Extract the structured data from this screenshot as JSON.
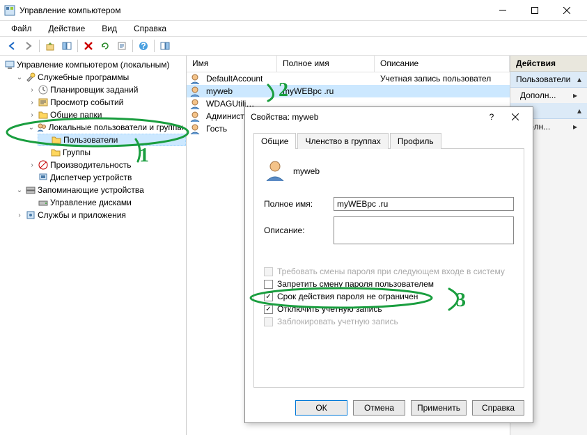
{
  "window": {
    "title": "Управление компьютером"
  },
  "menu": [
    "Файл",
    "Действие",
    "Вид",
    "Справка"
  ],
  "tree": {
    "root": "Управление компьютером (локальным)",
    "system_tools": "Служебные программы",
    "task_scheduler": "Планировщик заданий",
    "event_viewer": "Просмотр событий",
    "shared_folders": "Общие папки",
    "local_users": "Локальные пользователи и группы",
    "users": "Пользователи",
    "groups": "Группы",
    "performance": "Производительность",
    "device_manager": "Диспетчер устройств",
    "storage": "Запоминающие устройства",
    "disk_mgmt": "Управление дисками",
    "services_apps": "Службы и приложения"
  },
  "list": {
    "headers": {
      "name": "Имя",
      "fullname": "Полное имя",
      "description": "Описание"
    },
    "rows": [
      {
        "name": "DefaultAccount",
        "fullname": "",
        "description": "Учетная запись пользовател"
      },
      {
        "name": "myweb",
        "fullname": "myWEBpc .ru",
        "description": ""
      },
      {
        "name": "WDAGUtili…",
        "fullname": "",
        "description": ""
      },
      {
        "name": "Администр…",
        "fullname": "",
        "description": ""
      },
      {
        "name": "Гость",
        "fullname": "",
        "description": ""
      }
    ]
  },
  "actions": {
    "header": "Действия",
    "item1": "Пользователи",
    "sub1": "Дополн...",
    "sub2": "ополн..."
  },
  "dialog": {
    "title": "Свойства: myweb",
    "tabs": {
      "general": "Общие",
      "membership": "Членство в группах",
      "profile": "Профиль"
    },
    "username": "myweb",
    "fullname_label": "Полное имя:",
    "fullname_value": "myWEBpc .ru",
    "desc_label": "Описание:",
    "desc_value": "",
    "chk1": "Требовать смены пароля при следующем входе в систему",
    "chk2": "Запретить смену пароля пользователем",
    "chk3": "Срок действия пароля не ограничен",
    "chk4": "Отключить учетную запись",
    "chk5": "Заблокировать учетную запись",
    "buttons": {
      "ok": "ОК",
      "cancel": "Отмена",
      "apply": "Применить",
      "help": "Справка"
    }
  },
  "annotations": {
    "one": "1",
    "two": "2",
    "three": "3"
  }
}
